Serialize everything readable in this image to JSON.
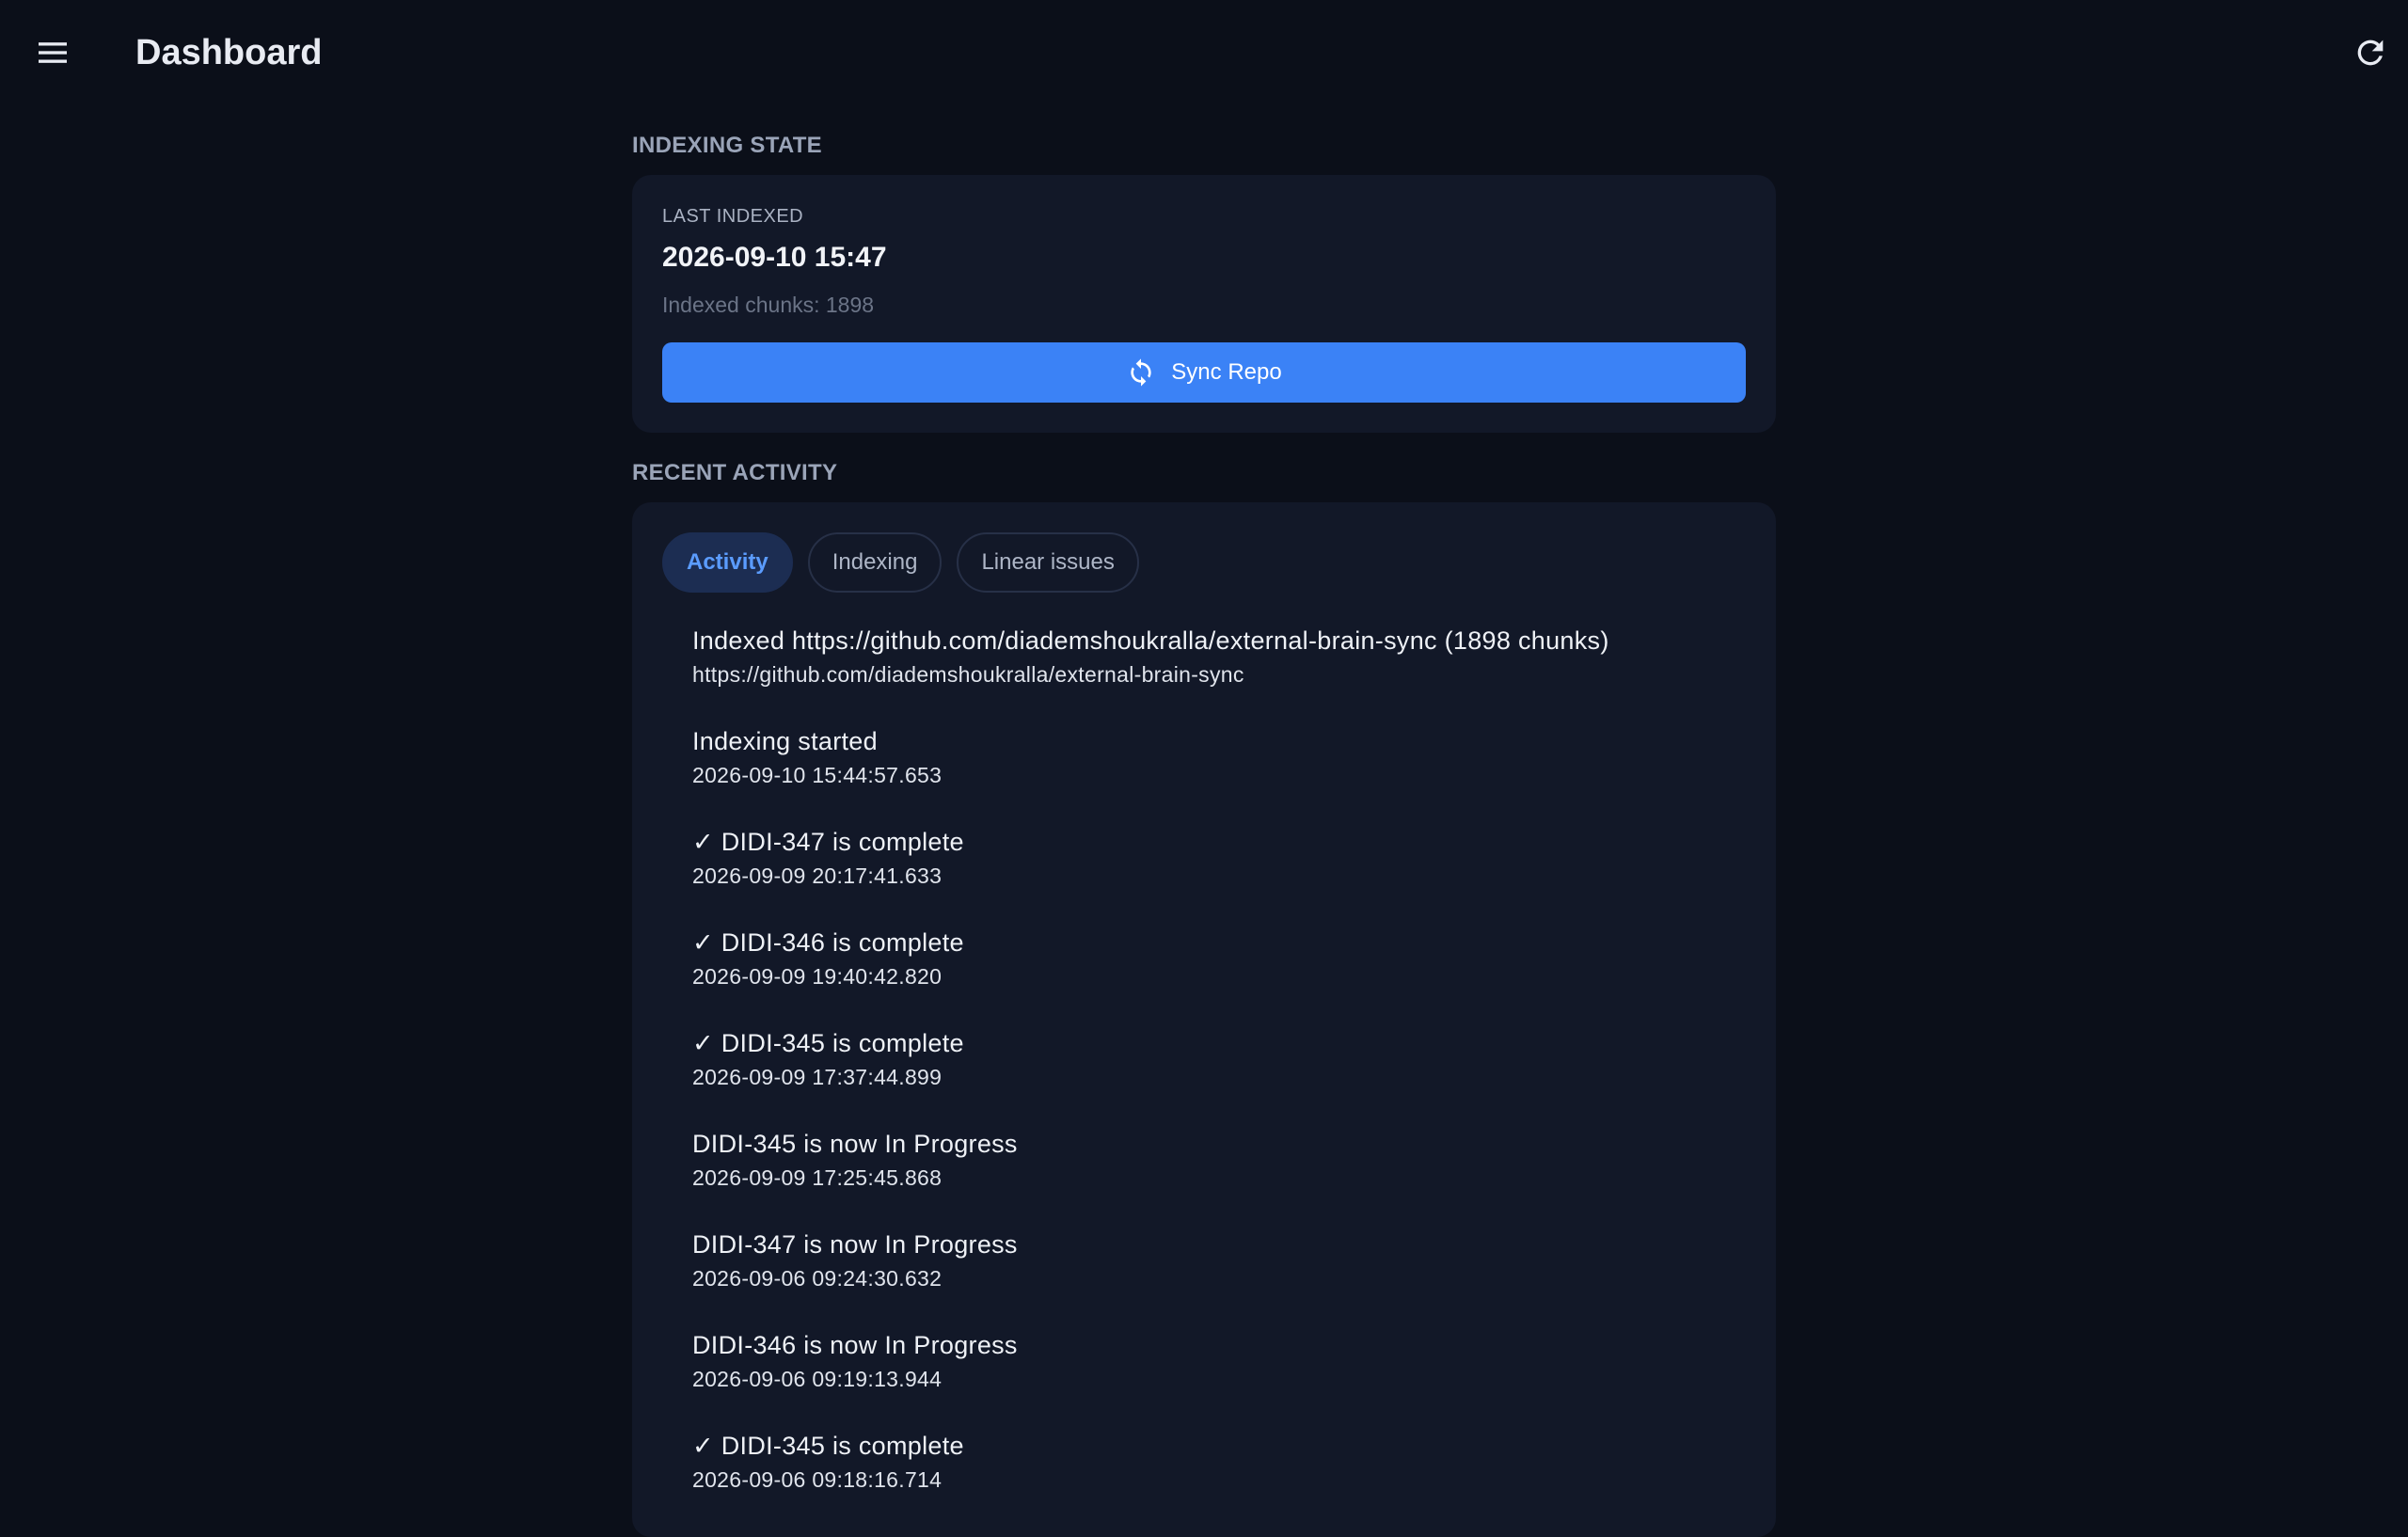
{
  "header": {
    "title": "Dashboard",
    "menu_icon": "hamburger-menu-icon",
    "refresh_icon": "refresh-icon"
  },
  "indexing_state": {
    "section_label": "INDEXING STATE",
    "last_indexed_label": "LAST INDEXED",
    "last_indexed_value": "2026-09-10 15:47",
    "chunks_text": "Indexed chunks: 1898",
    "sync_button_label": "Sync Repo",
    "sync_icon": "sync-icon"
  },
  "recent_activity": {
    "section_label": "RECENT ACTIVITY",
    "tabs": [
      {
        "label": "Activity",
        "active": true
      },
      {
        "label": "Indexing",
        "active": false
      },
      {
        "label": "Linear issues",
        "active": false
      }
    ],
    "items": [
      {
        "title": "Indexed https://github.com/diademshoukralla/external-brain-sync (1898 chunks)",
        "subtitle": "https://github.com/diademshoukralla/external-brain-sync"
      },
      {
        "title": "Indexing started",
        "subtitle": "2026-09-10 15:44:57.653"
      },
      {
        "title": "✓ DIDI-347 is complete",
        "subtitle": "2026-09-09 20:17:41.633"
      },
      {
        "title": "✓ DIDI-346 is complete",
        "subtitle": "2026-09-09 19:40:42.820"
      },
      {
        "title": "✓ DIDI-345 is complete",
        "subtitle": "2026-09-09 17:37:44.899"
      },
      {
        "title": "DIDI-345 is now In Progress",
        "subtitle": "2026-09-09 17:25:45.868"
      },
      {
        "title": "DIDI-347 is now In Progress",
        "subtitle": "2026-09-06 09:24:30.632"
      },
      {
        "title": "DIDI-346 is now In Progress",
        "subtitle": "2026-09-06 09:19:13.944"
      },
      {
        "title": "✓ DIDI-345 is complete",
        "subtitle": "2026-09-06 09:18:16.714"
      }
    ]
  },
  "colors": {
    "background": "#0b0f19",
    "card": "#121828",
    "accent": "#3b82f6",
    "active_tab_bg": "#1c2d52",
    "active_tab_text": "#5b9cff"
  }
}
